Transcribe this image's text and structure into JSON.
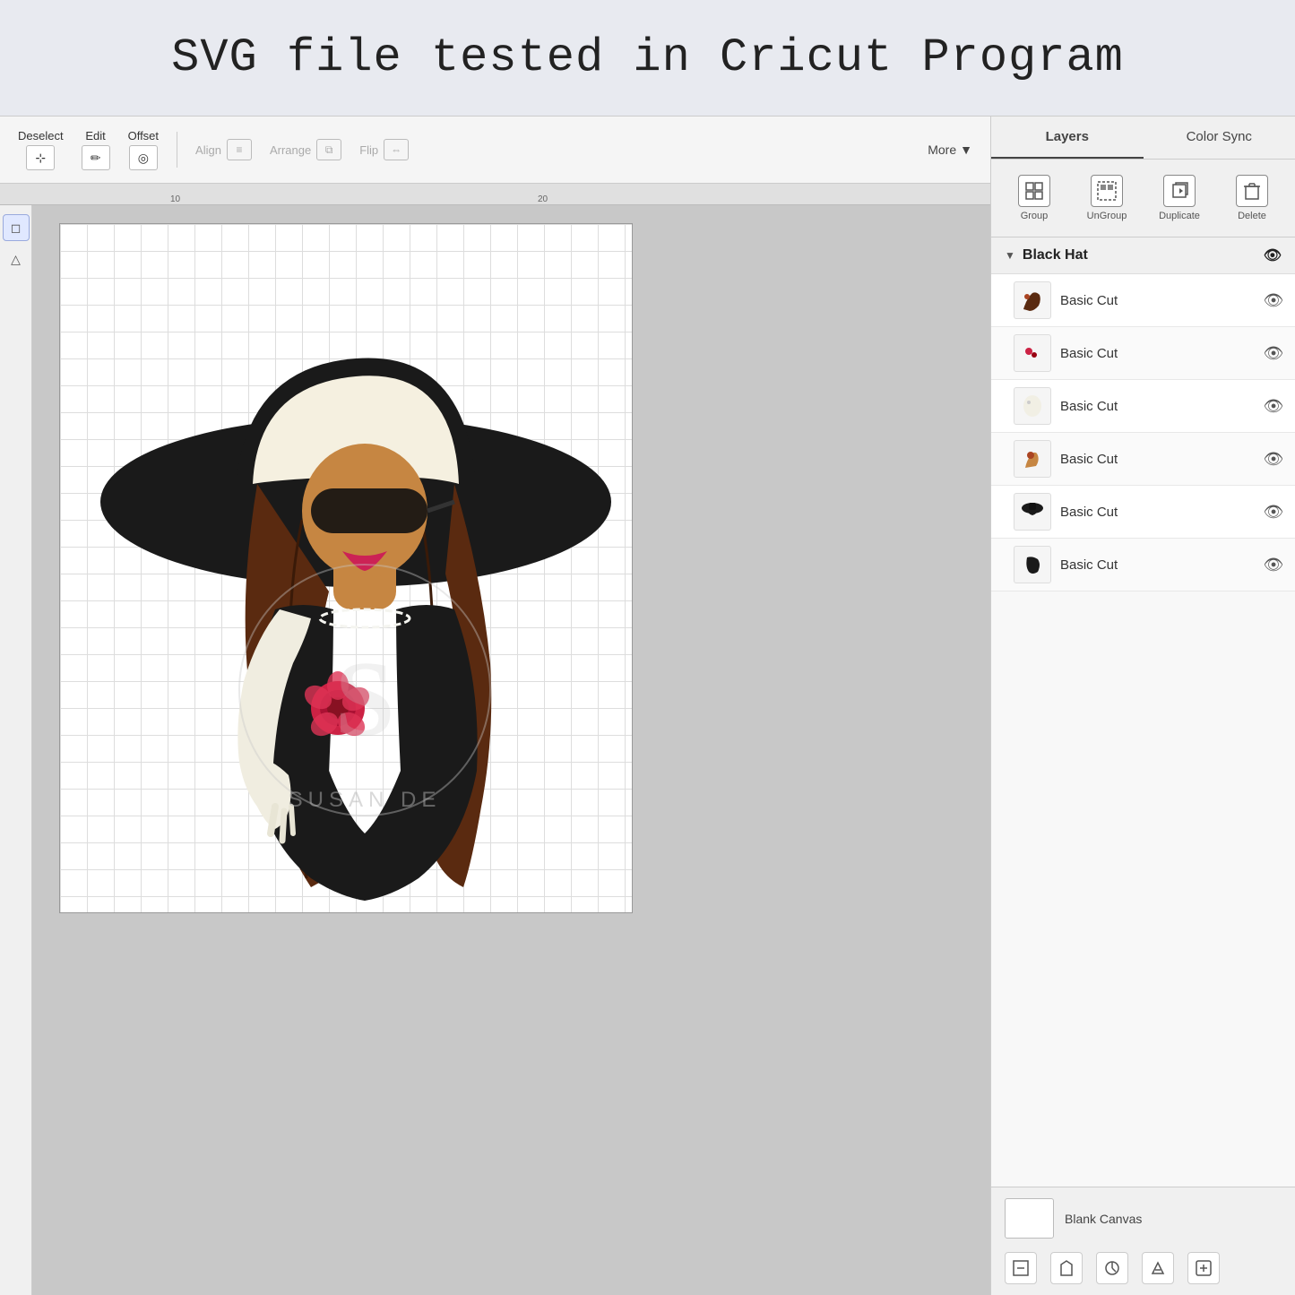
{
  "banner": {
    "title": "SVG file tested in Cricut Program"
  },
  "toolbar": {
    "deselect_label": "Deselect",
    "edit_label": "Edit",
    "offset_label": "Offset",
    "align_label": "Align",
    "arrange_label": "Arrange",
    "flip_label": "Flip",
    "more_label": "More"
  },
  "ruler": {
    "mark1": "10",
    "mark2": "20"
  },
  "panel": {
    "tab_layers": "Layers",
    "tab_color_sync": "Color Sync",
    "btn_group": "Group",
    "btn_ungroup": "UnGroup",
    "btn_duplicate": "Duplicate",
    "btn_delete": "Delete",
    "group_name": "Black Hat",
    "layers": [
      {
        "id": 1,
        "name": "Basic Cut",
        "visible": true
      },
      {
        "id": 2,
        "name": "Basic Cut",
        "visible": true
      },
      {
        "id": 3,
        "name": "Basic Cut",
        "visible": true
      },
      {
        "id": 4,
        "name": "Basic Cut",
        "visible": true
      },
      {
        "id": 5,
        "name": "Basic Cut",
        "visible": true
      },
      {
        "id": 6,
        "name": "Basic Cut",
        "visible": true
      }
    ],
    "blank_canvas_label": "Blank Canvas"
  },
  "watermark": "SUSAN DE",
  "colors": {
    "accent": "#5566aa",
    "banner_bg": "#e8eaf0",
    "panel_bg": "#f0f0f0"
  }
}
